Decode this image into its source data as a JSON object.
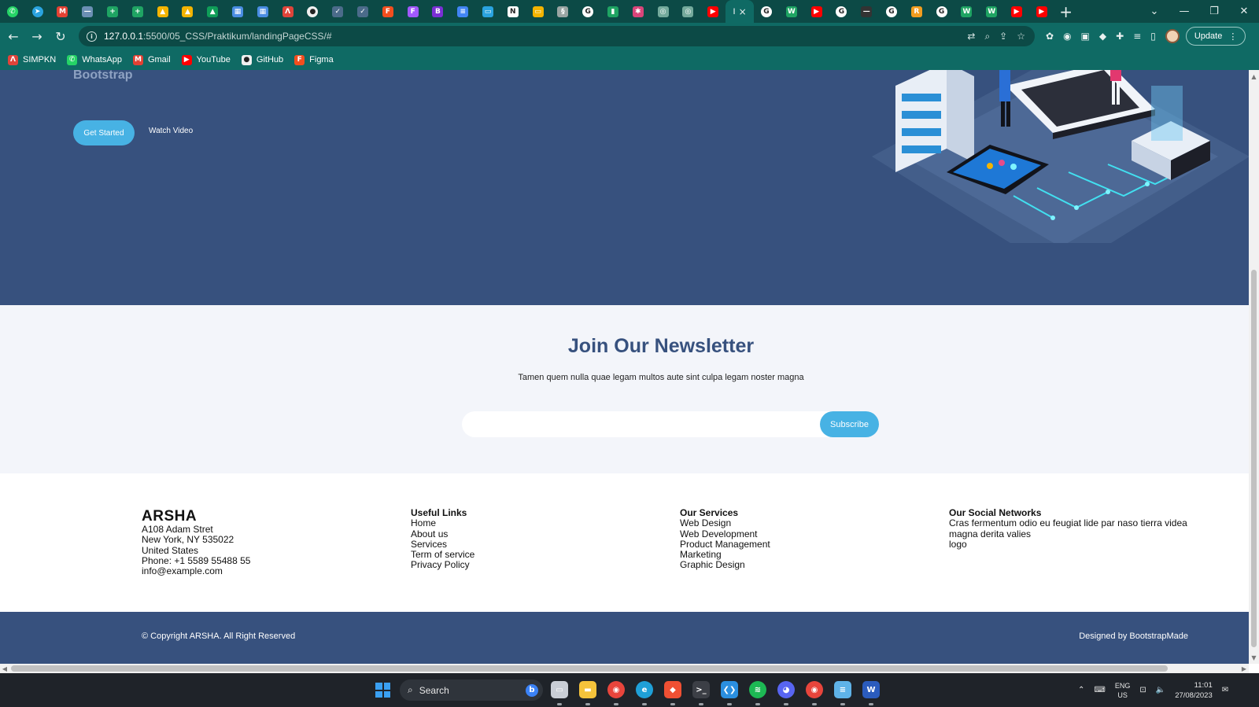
{
  "browser": {
    "tab_icons": [
      {
        "name": "whatsapp-icon",
        "color": "#25d366",
        "glyph": "✆",
        "round": true
      },
      {
        "name": "telegram-icon",
        "color": "#2aa3df",
        "glyph": "➤",
        "round": true
      },
      {
        "name": "gmail-icon",
        "color": "#e34133",
        "glyph": "M"
      },
      {
        "name": "generic-page-icon",
        "color": "#6b8fb3",
        "glyph": "—"
      },
      {
        "name": "sheets-icon",
        "color": "#1fa463",
        "glyph": "+"
      },
      {
        "name": "sheets-icon",
        "color": "#1fa463",
        "glyph": "+"
      },
      {
        "name": "drive-icon",
        "color": "#f4b400",
        "glyph": "▲"
      },
      {
        "name": "drive-icon",
        "color": "#f4b400",
        "glyph": "▲"
      },
      {
        "name": "drive-icon",
        "color": "#0f9d58",
        "glyph": "▲"
      },
      {
        "name": "calendar-icon",
        "color": "#4a8de2",
        "glyph": "▦"
      },
      {
        "name": "calendar-icon",
        "color": "#4a8de2",
        "glyph": "▦"
      },
      {
        "name": "simpkn-icon",
        "color": "#e0443a",
        "glyph": "Λ"
      },
      {
        "name": "github-icon",
        "color": "#f0f0f0",
        "glyph": "●",
        "round": true
      },
      {
        "name": "generic-page-icon",
        "color": "#4b6b8a",
        "glyph": "✓"
      },
      {
        "name": "generic-page-icon",
        "color": "#4b6b8a",
        "glyph": "✓"
      },
      {
        "name": "figma-icon",
        "color": "#f24e1e",
        "glyph": "F"
      },
      {
        "name": "figma-icon",
        "color": "#a259ff",
        "glyph": "F"
      },
      {
        "name": "bootstrap-icon",
        "color": "#7b2fd6",
        "glyph": "B"
      },
      {
        "name": "docs-icon",
        "color": "#4285f4",
        "glyph": "≡"
      },
      {
        "name": "laptop-icon",
        "color": "#2aa3df",
        "glyph": "▭"
      },
      {
        "name": "notion-icon",
        "color": "#ffffff",
        "glyph": "N"
      },
      {
        "name": "slides-icon",
        "color": "#f4b400",
        "glyph": "▭"
      },
      {
        "name": "generic-page-icon",
        "color": "#9aa5a3",
        "glyph": "§"
      },
      {
        "name": "google-icon",
        "color": "#ffffff",
        "glyph": "G",
        "round": true
      },
      {
        "name": "generic-page-icon",
        "color": "#1fa463",
        "glyph": "▮"
      },
      {
        "name": "generic-page-icon",
        "color": "#d9457a",
        "glyph": "✱"
      },
      {
        "name": "openai-icon",
        "color": "#74aa9c",
        "glyph": "◎"
      },
      {
        "name": "openai-icon",
        "color": "#74aa9c",
        "glyph": "◎"
      },
      {
        "name": "youtube-icon",
        "color": "#ff0000",
        "glyph": "▶"
      },
      {
        "name": "youtube-icon",
        "color": "#ff0000",
        "glyph": "▶"
      },
      {
        "name": "google-icon",
        "color": "#ffffff",
        "glyph": "G",
        "round": true
      },
      {
        "name": "w-icon",
        "color": "#1fa463",
        "glyph": "W"
      },
      {
        "name": "youtube-icon",
        "color": "#ff0000",
        "glyph": "▶"
      },
      {
        "name": "google-icon",
        "color": "#ffffff",
        "glyph": "G",
        "round": true
      },
      {
        "name": "generic-page-icon",
        "color": "#333333",
        "glyph": "—"
      },
      {
        "name": "google-icon",
        "color": "#ffffff",
        "glyph": "G",
        "round": true
      },
      {
        "name": "r-icon",
        "color": "#f29d1f",
        "glyph": "R"
      },
      {
        "name": "google-icon",
        "color": "#ffffff",
        "glyph": "G",
        "round": true
      },
      {
        "name": "w-icon",
        "color": "#1fa463",
        "glyph": "W"
      },
      {
        "name": "w-icon",
        "color": "#1fa463",
        "glyph": "W"
      },
      {
        "name": "youtube-icon",
        "color": "#ff0000",
        "glyph": "▶"
      },
      {
        "name": "youtube-icon",
        "color": "#ff0000",
        "glyph": "▶"
      }
    ],
    "active_tab_index": 29,
    "active_tab_label": "I",
    "close_glyph": "×",
    "newtab_glyph": "+",
    "window_controls": {
      "dropdown": "⌄",
      "minimize": "—",
      "restore": "❐",
      "close": "✕"
    },
    "nav": {
      "back": "←",
      "forward": "→",
      "reload": "↻"
    },
    "url_host": "127.0.0.1",
    "url_rest": ":5500/05_CSS/Praktikum/landingPageCSS/#",
    "omnibox_icons": [
      {
        "name": "translate-icon",
        "glyph": "⇄"
      },
      {
        "name": "zoom-icon",
        "glyph": "⌕"
      },
      {
        "name": "share-icon",
        "glyph": "⇪"
      },
      {
        "name": "bookmark-star-icon",
        "glyph": "☆"
      }
    ],
    "extension_icons": [
      {
        "name": "extension-bug-icon",
        "glyph": "✿"
      },
      {
        "name": "camera-icon",
        "glyph": "◉"
      },
      {
        "name": "extension-book-icon",
        "glyph": "▣"
      },
      {
        "name": "extension-diamond-icon",
        "glyph": "◆"
      },
      {
        "name": "extensions-puzzle-icon",
        "glyph": "✚"
      },
      {
        "name": "media-queue-icon",
        "glyph": "≡"
      },
      {
        "name": "side-panel-icon",
        "glyph": "▯"
      }
    ],
    "update_label": "Update",
    "update_menu_glyph": "⋮",
    "bookmarks": [
      {
        "name": "simpkn",
        "label": "SIMPKN",
        "color": "#e0443a",
        "glyph": "Λ"
      },
      {
        "name": "whatsapp",
        "label": "WhatsApp",
        "color": "#25d366",
        "glyph": "✆"
      },
      {
        "name": "gmail",
        "label": "Gmail",
        "color": "#e34133",
        "glyph": "M"
      },
      {
        "name": "youtube",
        "label": "YouTube",
        "color": "#ff0000",
        "glyph": "▶"
      },
      {
        "name": "github",
        "label": "GitHub",
        "color": "#f0f0f0",
        "glyph": "●"
      },
      {
        "name": "figma",
        "label": "Figma",
        "color": "#f24e1e",
        "glyph": "F"
      }
    ]
  },
  "page": {
    "hero": {
      "tagline": "Bootstrap",
      "get_started": "Get Started",
      "watch_video": "Watch Video"
    },
    "newsletter": {
      "title": "Join Our Newsletter",
      "subtitle": "Tamen quem nulla quae legam multos aute sint culpa legam noster magna",
      "input_value": "",
      "subscribe": "Subscribe"
    },
    "footer": {
      "brand": "ARSHA",
      "address": [
        "A108 Adam Stret",
        "New York, NY 535022",
        "United States",
        "Phone: +1 5589 55488 55",
        "info@example.com"
      ],
      "links_title": "Useful Links",
      "links": [
        "Home",
        "About us",
        "Services",
        "Term of service",
        "Privacy Policy"
      ],
      "services_title": "Our Services",
      "services": [
        "Web Design",
        "Web Development",
        "Product Management",
        "Marketing",
        "Graphic Design"
      ],
      "social_title": "Our Social Networks",
      "social_text": "Cras fermentum odio eu feugiat lide par naso tierra videa magna derita valies",
      "social_logo": "logo",
      "copyright": "© Copyright ARSHA. All Right Reserved",
      "credits": "Designed by BootstrapMade"
    }
  },
  "colors": {
    "primary": "#37517e",
    "accent": "#47b2e4",
    "light_bg": "#f3f5fa",
    "chrome": "#0f6a64"
  },
  "taskbar": {
    "search_placeholder": "Search",
    "apps": [
      {
        "name": "task-view-icon",
        "color": "#c9ced6",
        "glyph": "▭"
      },
      {
        "name": "file-explorer-icon",
        "color": "#f5c33b",
        "glyph": "▬"
      },
      {
        "name": "chrome-icon",
        "color": "#e8453c",
        "glyph": "◉",
        "round": true
      },
      {
        "name": "edge-icon",
        "color": "#1fa0d8",
        "glyph": "e",
        "round": true
      },
      {
        "name": "git-icon",
        "color": "#f05033",
        "glyph": "◆"
      },
      {
        "name": "terminal-icon",
        "color": "#3c3f46",
        "glyph": ">_"
      },
      {
        "name": "vscode-icon",
        "color": "#2b8fe0",
        "glyph": "❮❯"
      },
      {
        "name": "spotify-icon",
        "color": "#1db954",
        "glyph": "≋",
        "round": true
      },
      {
        "name": "discord-icon",
        "color": "#5865f2",
        "glyph": "◕",
        "round": true
      },
      {
        "name": "chrome-profile-icon",
        "color": "#e8453c",
        "glyph": "◉",
        "round": true
      },
      {
        "name": "notepad-icon",
        "color": "#5fb3e8",
        "glyph": "≡"
      },
      {
        "name": "word-icon",
        "color": "#2b5cbd",
        "glyph": "W"
      }
    ],
    "tray": {
      "chevron": "⌃",
      "keyboard": "⌨",
      "lang_top": "ENG",
      "lang_bottom": "US",
      "network": "⊡",
      "volume": "🔈",
      "time": "11:01",
      "date": "27/08/2023",
      "notification": "✉"
    }
  }
}
